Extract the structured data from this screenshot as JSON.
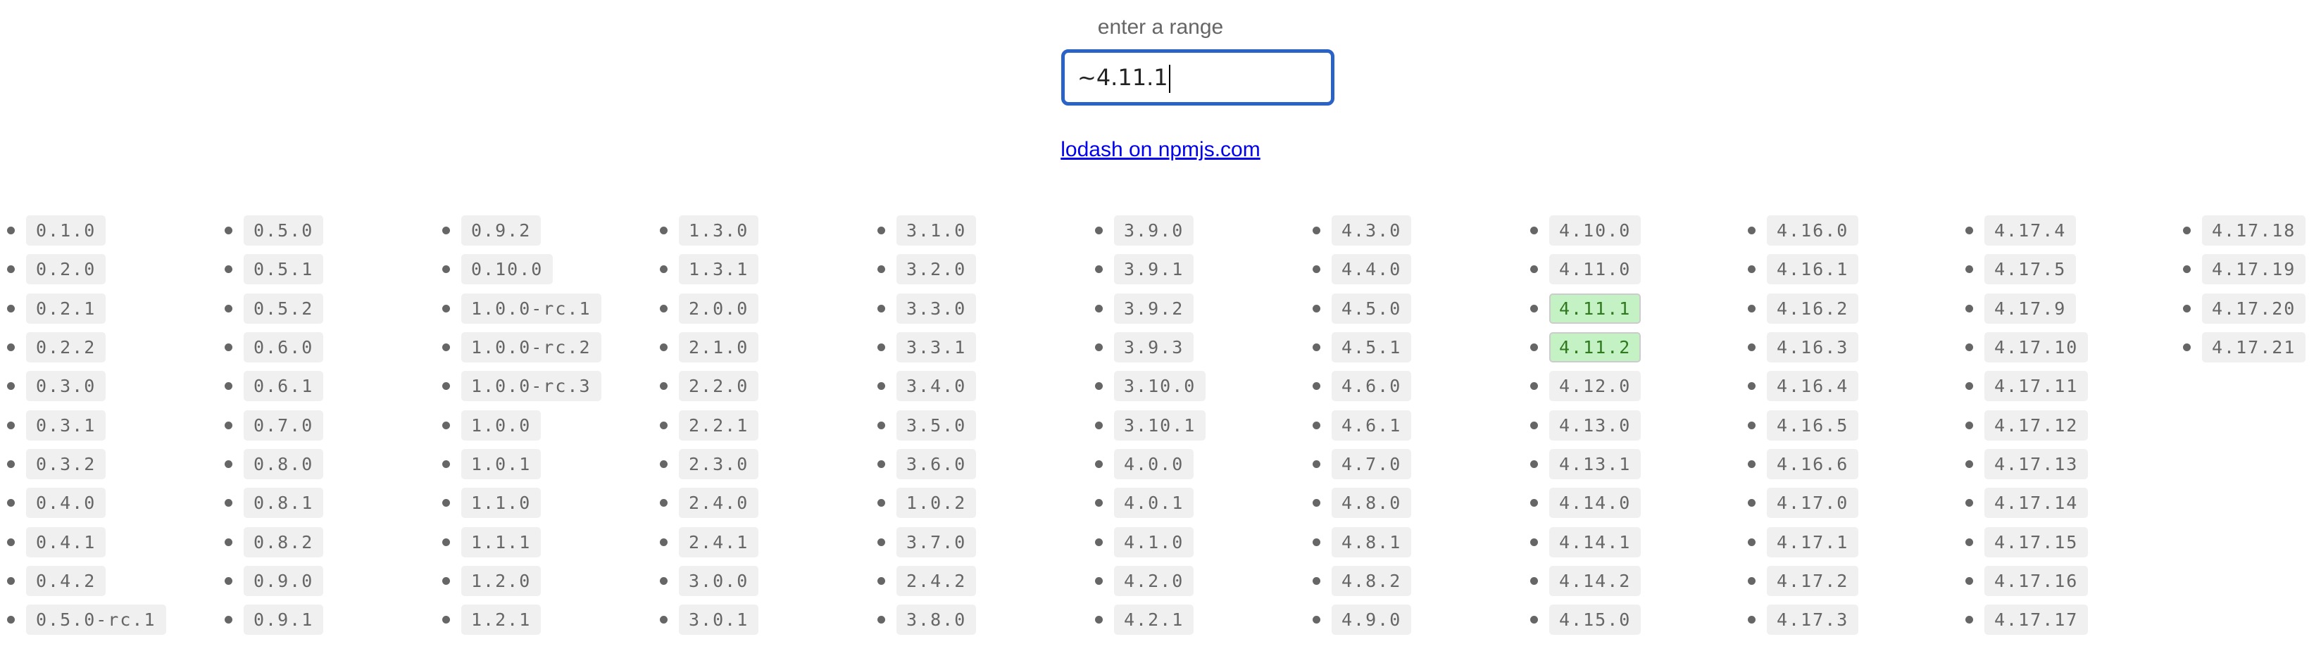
{
  "label": "enter a range",
  "input": {
    "value": "~4.11.1"
  },
  "link": "lodash on npmjs.com",
  "colors": {
    "match_bg": "#c5f2c5",
    "match_text": "#2f7a1f",
    "input_border": "#2b62c6"
  },
  "matched": [
    "4.11.1",
    "4.11.2"
  ],
  "columns": [
    [
      "0.1.0",
      "0.2.0",
      "0.2.1",
      "0.2.2",
      "0.3.0",
      "0.3.1",
      "0.3.2",
      "0.4.0",
      "0.4.1",
      "0.4.2",
      "0.5.0-rc.1"
    ],
    [
      "0.5.0",
      "0.5.1",
      "0.5.2",
      "0.6.0",
      "0.6.1",
      "0.7.0",
      "0.8.0",
      "0.8.1",
      "0.8.2",
      "0.9.0",
      "0.9.1"
    ],
    [
      "0.9.2",
      "0.10.0",
      "1.0.0-rc.1",
      "1.0.0-rc.2",
      "1.0.0-rc.3",
      "1.0.0",
      "1.0.1",
      "1.1.0",
      "1.1.1",
      "1.2.0",
      "1.2.1"
    ],
    [
      "1.3.0",
      "1.3.1",
      "2.0.0",
      "2.1.0",
      "2.2.0",
      "2.2.1",
      "2.3.0",
      "2.4.0",
      "2.4.1",
      "3.0.0",
      "3.0.1"
    ],
    [
      "3.1.0",
      "3.2.0",
      "3.3.0",
      "3.3.1",
      "3.4.0",
      "3.5.0",
      "3.6.0",
      "1.0.2",
      "3.7.0",
      "2.4.2",
      "3.8.0"
    ],
    [
      "3.9.0",
      "3.9.1",
      "3.9.2",
      "3.9.3",
      "3.10.0",
      "3.10.1",
      "4.0.0",
      "4.0.1",
      "4.1.0",
      "4.2.0",
      "4.2.1"
    ],
    [
      "4.3.0",
      "4.4.0",
      "4.5.0",
      "4.5.1",
      "4.6.0",
      "4.6.1",
      "4.7.0",
      "4.8.0",
      "4.8.1",
      "4.8.2",
      "4.9.0"
    ],
    [
      "4.10.0",
      "4.11.0",
      "4.11.1",
      "4.11.2",
      "4.12.0",
      "4.13.0",
      "4.13.1",
      "4.14.0",
      "4.14.1",
      "4.14.2",
      "4.15.0"
    ],
    [
      "4.16.0",
      "4.16.1",
      "4.16.2",
      "4.16.3",
      "4.16.4",
      "4.16.5",
      "4.16.6",
      "4.17.0",
      "4.17.1",
      "4.17.2",
      "4.17.3"
    ],
    [
      "4.17.4",
      "4.17.5",
      "4.17.9",
      "4.17.10",
      "4.17.11",
      "4.17.12",
      "4.17.13",
      "4.17.14",
      "4.17.15",
      "4.17.16",
      "4.17.17"
    ],
    [
      "4.17.18",
      "4.17.19",
      "4.17.20",
      "4.17.21"
    ]
  ]
}
